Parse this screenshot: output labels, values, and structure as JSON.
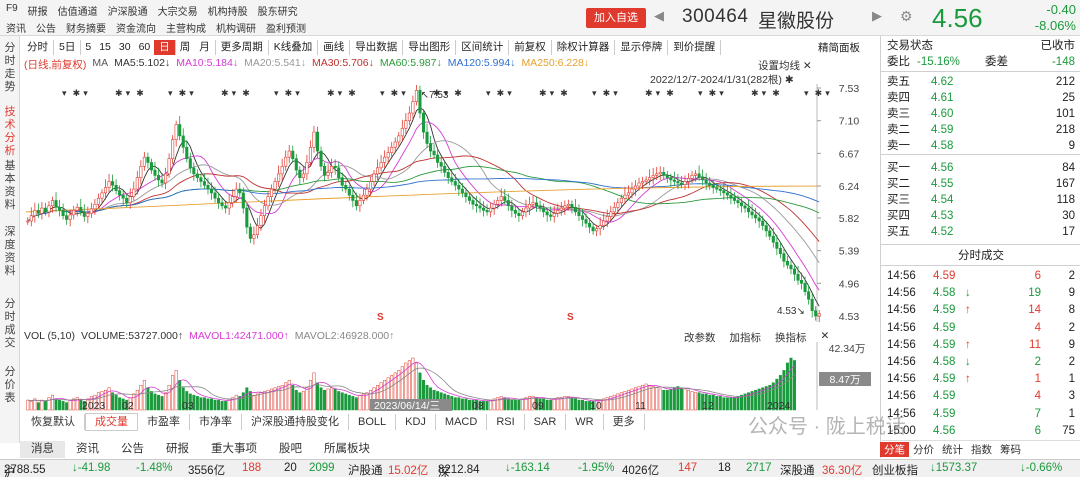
{
  "topmenu": {
    "row1": [
      "F9",
      "研报",
      "估值通道",
      "沪深股通",
      "大宗交易",
      "机构持股",
      "股东研究"
    ],
    "row2": [
      "资讯",
      "公告",
      "财务摘要",
      "资金流向",
      "主营构成",
      "机构调研",
      "盈利预测"
    ]
  },
  "header": {
    "add_button": "加入自选",
    "code": "300464",
    "name": "星徽股份",
    "price": "4.56",
    "change": "-0.40",
    "change_pct": "-8.06%",
    "up_color": "#e03a2e",
    "down_color": "#1a9a3c"
  },
  "leftnav": [
    {
      "label": "分时走势",
      "active": false
    },
    {
      "label": "技术分析",
      "active": true
    },
    {
      "label": "基本资料",
      "active": false
    },
    {
      "label": "深度资料",
      "active": false
    },
    {
      "label": "分时成交",
      "active": false
    },
    {
      "label": "分价表",
      "active": false
    }
  ],
  "chart_toolbar": {
    "items": [
      "分时",
      "5日",
      "5",
      "15",
      "30",
      "60",
      "日",
      "周",
      "月",
      "更多周期",
      "K线叠加",
      "画线",
      "导出数据",
      "导出图形",
      "区间统计",
      "前复权",
      "除权计算器",
      "显示停牌",
      "到价提醒"
    ],
    "selected": "日",
    "panel_button": "精简面板"
  },
  "ma_legend": {
    "prefix": "(日线,前复权)",
    "items": [
      {
        "text": "MA",
        "color": "#555555"
      },
      {
        "text": "MA5:5.102↓",
        "color": "#333333"
      },
      {
        "text": "MA10:5.184↓",
        "color": "#d63ad6"
      },
      {
        "text": "MA20:5.541↓",
        "color": "#999999"
      },
      {
        "text": "MA30:5.706↓",
        "color": "#c03030"
      },
      {
        "text": "MA60:5.987↓",
        "color": "#2a9a3a"
      },
      {
        "text": "MA120:5.994↓",
        "color": "#3070d0"
      },
      {
        "text": "MA250:6.228↓",
        "color": "#e8a030"
      }
    ],
    "settings": "设置均线",
    "date_range": "2022/12/7-2024/1/31(282根)"
  },
  "price_axis": [
    "7.53",
    "7.10",
    "6.67",
    "6.24",
    "5.82",
    "5.39",
    "4.96",
    "4.53"
  ],
  "annotations": {
    "high": "7.53",
    "low": "4.53"
  },
  "volume_header": {
    "items": [
      {
        "text": "VOL (5,10)",
        "color": "#333333"
      },
      {
        "text": "VOLUME:53727.000↑",
        "color": "#333333"
      },
      {
        "text": "MAVOL1:42471.000↑",
        "color": "#d63ad6"
      },
      {
        "text": "MAVOL2:46928.000↑",
        "color": "#888888"
      }
    ],
    "tools": [
      "改参数",
      "加指标",
      "换指标"
    ],
    "axis_top": "42.34万",
    "axis_mid": "8.47万"
  },
  "x_axis": [
    "2023",
    "02",
    "03",
    "2023/06/14/三",
    "08",
    "09",
    "10",
    "11",
    "12",
    "2024"
  ],
  "indicator_tabs": {
    "items": [
      "恢复默认",
      "成交量",
      "市盈率",
      "市净率",
      "沪深股通持股变化",
      "BOLL",
      "KDJ",
      "MACD",
      "RSI",
      "SAR",
      "WR",
      "更多"
    ],
    "selected": "成交量"
  },
  "bottom_tabs": {
    "items": [
      "消息",
      "资讯",
      "公告",
      "研报",
      "重大事项",
      "股吧",
      "所属板块"
    ],
    "selected": "消息"
  },
  "orderbook": {
    "title": "交易状态",
    "status": "已收市",
    "ratio_label": "委比",
    "ratio": "-15.16%",
    "diff_label": "委差",
    "diff": "-148",
    "asks": [
      {
        "label": "卖五",
        "price": "4.62",
        "vol": "212"
      },
      {
        "label": "卖四",
        "price": "4.61",
        "vol": "25"
      },
      {
        "label": "卖三",
        "price": "4.60",
        "vol": "101"
      },
      {
        "label": "卖二",
        "price": "4.59",
        "vol": "218"
      },
      {
        "label": "卖一",
        "price": "4.58",
        "vol": "9"
      }
    ],
    "bids": [
      {
        "label": "买一",
        "price": "4.56",
        "vol": "84"
      },
      {
        "label": "买二",
        "price": "4.55",
        "vol": "167"
      },
      {
        "label": "买三",
        "price": "4.54",
        "vol": "118"
      },
      {
        "label": "买四",
        "price": "4.53",
        "vol": "30"
      },
      {
        "label": "买五",
        "price": "4.52",
        "vol": "17"
      }
    ]
  },
  "ticks": {
    "title": "分时成交",
    "rows": [
      {
        "time": "14:56",
        "price": "4.59",
        "arrow": "",
        "vol": "6",
        "num": "2",
        "pc": "red",
        "vc": "red"
      },
      {
        "time": "14:56",
        "price": "4.58",
        "arrow": "↓",
        "vol": "19",
        "num": "9",
        "pc": "green",
        "vc": "green"
      },
      {
        "time": "14:56",
        "price": "4.59",
        "arrow": "↑",
        "vol": "14",
        "num": "8",
        "pc": "green",
        "vc": "red"
      },
      {
        "time": "14:56",
        "price": "4.59",
        "arrow": "",
        "vol": "4",
        "num": "2",
        "pc": "green",
        "vc": "red"
      },
      {
        "time": "14:56",
        "price": "4.59",
        "arrow": "↑",
        "vol": "11",
        "num": "9",
        "pc": "green",
        "vc": "red"
      },
      {
        "time": "14:56",
        "price": "4.58",
        "arrow": "↓",
        "vol": "2",
        "num": "2",
        "pc": "green",
        "vc": "green"
      },
      {
        "time": "14:56",
        "price": "4.59",
        "arrow": "↑",
        "vol": "1",
        "num": "1",
        "pc": "green",
        "vc": "red"
      },
      {
        "time": "14:56",
        "price": "4.59",
        "arrow": "",
        "vol": "4",
        "num": "3",
        "pc": "green",
        "vc": "red"
      },
      {
        "time": "14:56",
        "price": "4.59",
        "arrow": "",
        "vol": "7",
        "num": "1",
        "pc": "green",
        "vc": "green"
      },
      {
        "time": "15:00",
        "price": "4.56",
        "arrow": "",
        "vol": "6",
        "num": "75",
        "pc": "green",
        "vc": "green"
      }
    ]
  },
  "right_tabs": {
    "items": [
      "分笔",
      "分价",
      "统计",
      "指数",
      "筹码"
    ],
    "selected": "分笔"
  },
  "watermark": "公众号 · 陇上税话",
  "statusbar": {
    "sh_label": "沪",
    "sh_index": "2788.55",
    "sh_chg": "↓-41.98",
    "sh_pct": "-1.48%",
    "sh_amt": "3556亿",
    "sh_n1": "188",
    "sh_n2": "20",
    "sh_n3": "2099",
    "hgt_label": "沪股通",
    "hgt_val": "15.02亿",
    "sz_label": "深",
    "sz_index": "8212.84",
    "sz_chg": "↓-163.14",
    "sz_pct": "-1.95%",
    "sz_amt": "4026亿",
    "sz_n1": "147",
    "sz_n2": "18",
    "sz_n3": "2717",
    "sgt_label": "深股通",
    "sgt_val": "36.30亿",
    "cyb_label": "创业板指",
    "cyb_val": "↓1573.37",
    "cyb_pct": "↓-0.66%"
  },
  "chart_data": {
    "type": "candlestick",
    "ylim": [
      4.53,
      7.53
    ],
    "close_series": [
      5.78,
      5.85,
      5.92,
      5.88,
      5.95,
      5.9,
      5.98,
      6.05,
      5.96,
      5.92,
      5.85,
      5.8,
      5.86,
      5.92,
      5.96,
      5.9,
      5.84,
      5.88,
      5.94,
      6.0,
      6.08,
      6.15,
      6.22,
      6.3,
      6.25,
      6.18,
      6.12,
      6.08,
      6.02,
      6.1,
      6.2,
      6.35,
      6.5,
      6.62,
      6.55,
      6.45,
      6.38,
      6.32,
      6.28,
      6.4,
      6.6,
      6.85,
      7.05,
      6.9,
      6.75,
      6.6,
      6.48,
      6.4,
      6.35,
      6.3,
      6.25,
      6.2,
      6.15,
      6.08,
      6.02,
      5.98,
      5.95,
      6.02,
      6.1,
      6.2,
      6.15,
      5.95,
      5.7,
      5.55,
      5.6,
      5.72,
      5.85,
      5.98,
      6.1,
      6.2,
      6.3,
      6.4,
      6.5,
      6.62,
      6.7,
      6.6,
      6.45,
      6.35,
      6.4,
      6.55,
      6.75,
      6.95,
      6.7,
      6.5,
      6.38,
      6.42,
      6.5,
      6.48,
      6.35,
      6.25,
      6.2,
      6.12,
      6.05,
      5.98,
      6.05,
      6.12,
      6.2,
      6.3,
      6.4,
      6.48,
      6.55,
      6.62,
      6.68,
      6.75,
      6.82,
      6.9,
      7.0,
      7.1,
      7.2,
      7.35,
      7.5,
      7.2,
      6.95,
      6.8,
      6.7,
      6.65,
      6.55,
      6.5,
      6.42,
      6.35,
      6.3,
      6.25,
      6.2,
      6.15,
      6.1,
      6.05,
      6.0,
      5.98,
      5.95,
      5.92,
      5.9,
      5.95,
      6.0,
      6.05,
      6.1,
      6.05,
      5.98,
      5.92,
      5.88,
      5.85,
      5.9,
      5.95,
      6.0,
      6.02,
      5.98,
      5.95,
      5.9,
      5.86,
      5.84,
      5.88,
      5.92,
      5.95,
      5.98,
      6.0,
      5.96,
      5.9,
      5.85,
      5.8,
      5.75,
      5.7,
      5.65,
      5.68,
      5.72,
      5.78,
      5.84,
      5.9,
      5.96,
      6.02,
      6.08,
      6.12,
      6.15,
      6.2,
      6.24,
      6.28,
      6.3,
      6.32,
      6.35,
      6.38,
      6.4,
      6.42,
      6.38,
      6.35,
      6.32,
      6.3,
      6.28,
      6.26,
      6.3,
      6.34,
      6.38,
      6.4,
      6.36,
      6.32,
      6.28,
      6.25,
      6.22,
      6.2,
      6.18,
      6.15,
      6.12,
      6.08,
      6.05,
      6.02,
      5.98,
      5.95,
      5.9,
      5.86,
      5.82,
      5.78,
      5.72,
      5.65,
      5.58,
      5.5,
      5.42,
      5.35,
      5.25,
      5.2,
      5.15,
      5.08,
      5.0,
      4.96,
      4.85,
      4.75,
      4.6,
      4.53,
      4.56
    ],
    "volume_series": [
      8,
      7,
      9,
      6,
      8,
      7,
      10,
      12,
      9,
      8,
      7,
      6,
      8,
      9,
      10,
      8,
      7,
      9,
      11,
      12,
      14,
      15,
      16,
      18,
      14,
      12,
      10,
      9,
      8,
      10,
      13,
      16,
      20,
      24,
      18,
      15,
      13,
      12,
      11,
      14,
      20,
      28,
      32,
      24,
      18,
      15,
      13,
      12,
      11,
      10,
      10,
      9,
      9,
      8,
      8,
      7,
      7,
      9,
      10,
      12,
      11,
      14,
      18,
      15,
      12,
      13,
      14,
      15,
      16,
      17,
      18,
      19,
      20,
      22,
      24,
      20,
      16,
      14,
      15,
      18,
      24,
      30,
      22,
      18,
      16,
      17,
      18,
      17,
      15,
      14,
      13,
      12,
      11,
      10,
      12,
      13,
      14,
      16,
      18,
      20,
      22,
      24,
      26,
      28,
      30,
      32,
      35,
      38,
      40,
      42,
      38,
      30,
      24,
      20,
      18,
      16,
      15,
      14,
      13,
      12,
      11,
      10,
      10,
      9,
      9,
      8,
      8,
      8,
      7,
      7,
      7,
      8,
      9,
      10,
      11,
      10,
      9,
      8,
      8,
      8,
      9,
      10,
      11,
      11,
      10,
      9,
      9,
      8,
      8,
      9,
      10,
      10,
      11,
      11,
      10,
      9,
      8,
      8,
      7,
      7,
      7,
      8,
      8,
      9,
      10,
      11,
      12,
      13,
      14,
      15,
      16,
      17,
      18,
      19,
      20,
      21,
      20,
      19,
      18,
      17,
      16,
      16,
      17,
      18,
      19,
      18,
      17,
      16,
      15,
      14,
      14,
      13,
      13,
      12,
      12,
      11,
      11,
      10,
      10,
      10,
      10,
      11,
      12,
      13,
      14,
      15,
      16,
      17,
      18,
      19,
      20,
      22,
      25,
      28,
      32,
      38,
      42,
      40
    ]
  }
}
